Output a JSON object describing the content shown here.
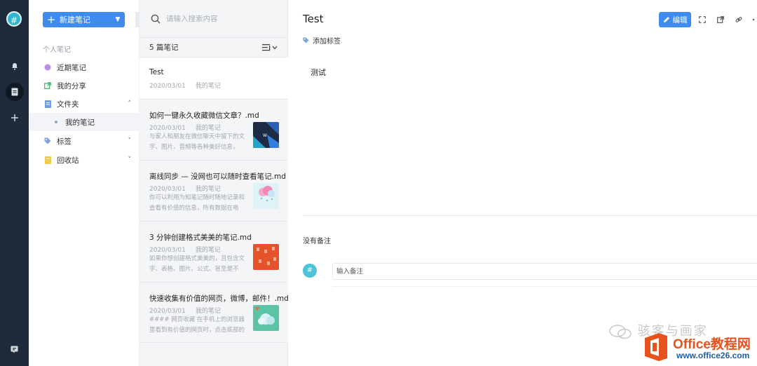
{
  "app": {
    "logo_glyph": "#",
    "accent": "#3f8cf0"
  },
  "rail": {
    "items": [
      {
        "icon": "bell-icon"
      },
      {
        "icon": "notebook-icon",
        "active": true
      },
      {
        "icon": "plus-icon"
      },
      {
        "icon": "feedback-icon"
      }
    ]
  },
  "sidebar": {
    "new_note_label": "新建笔记",
    "group_label": "个人笔记",
    "items": [
      {
        "label": "近期笔记",
        "icon": "recent-icon"
      },
      {
        "label": "我的分享",
        "icon": "share-icon"
      },
      {
        "label": "文件夹",
        "icon": "folder-icon",
        "expanded": true
      },
      {
        "label": "我的笔记",
        "icon": "dot-icon",
        "selected": true
      },
      {
        "label": "标签",
        "icon": "tag-icon"
      },
      {
        "label": "回收站",
        "icon": "trash-icon"
      }
    ]
  },
  "list": {
    "search_placeholder": "请输入搜索内容",
    "count_label": "5 篇笔记",
    "notes": [
      {
        "title": "Test",
        "date": "2020/03/01",
        "folder": "我的笔记",
        "excerpt": ""
      },
      {
        "title": "如何一键永久收藏微信文章？.md",
        "date": "2020/03/01",
        "folder": "我的笔记",
        "excerpt": "与家人和朋友在微信聊天中留下的文字、图片、音频等各种美好信息，常…"
      },
      {
        "title": "离线同步 — 没网也可以随时查看笔记.md",
        "date": "2020/03/01",
        "folder": "我的笔记",
        "excerpt": "你可以利用为知笔记随时随地记录和查看有价值的信息，所有数据在电脑、…"
      },
      {
        "title": "3 分钟创建格式美美的笔记.md",
        "date": "2020/03/01",
        "folder": "我的笔记",
        "excerpt": "如果你想创建格式美美的，且包含文字、表格、图片、公式、甚至是不同…"
      },
      {
        "title": "快速收集有价值的网页，微博，邮件！.md",
        "date": "2020/03/01",
        "folder": "我的笔记",
        "excerpt": "#### 网页收藏 在手机上的浏览器里看到有价值的网页时，点击底部的 **…"
      }
    ]
  },
  "editor": {
    "title": "Test",
    "edit_label": "编辑",
    "add_tag_label": "添加标签",
    "body": "测试",
    "no_comment_label": "没有备注",
    "comment_avatar": "#",
    "comment_placeholder": "输入备注"
  },
  "watermark": {
    "channel": "骇客与画家",
    "brand": "Office教程网",
    "site": "www.office26.com"
  }
}
